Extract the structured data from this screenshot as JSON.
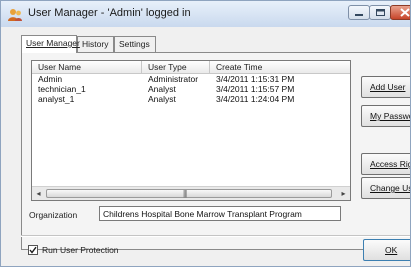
{
  "window": {
    "title": "User Manager - 'Admin' logged in"
  },
  "tabs": [
    {
      "label": "User Manager",
      "active": true
    },
    {
      "label": "History",
      "active": false
    },
    {
      "label": "Settings",
      "active": false
    }
  ],
  "user_table": {
    "columns": [
      "User Name",
      "User Type",
      "Create Time"
    ],
    "rows": [
      {
        "name": "Admin",
        "type": "Administrator",
        "created": "3/4/2011 1:15:31 PM"
      },
      {
        "name": "technician_1",
        "type": "Analyst",
        "created": "3/4/2011 1:15:57 PM"
      },
      {
        "name": "analyst_1",
        "type": "Analyst",
        "created": "3/4/2011 1:24:04 PM"
      }
    ]
  },
  "actions": {
    "add_user": "Add User",
    "my_password": "My Password",
    "access_rights": "Access Rights",
    "change_user": "Change User"
  },
  "organization": {
    "label": "Organization",
    "value": "Childrens Hospital Bone Marrow Transplant Program"
  },
  "protection": {
    "label": "Run User Protection",
    "checked": true
  },
  "ok_label": "OK",
  "icons": {
    "app": "user-manager-icon",
    "minimize": "minimize-icon",
    "maximize": "maximize-icon",
    "close": "close-icon",
    "scroll_left": "arrow-left-icon",
    "scroll_right": "arrow-right-icon",
    "check": "checkmark-icon"
  },
  "colors": {
    "title_gradient_top": "#e8f0fa",
    "title_gradient_bottom": "#c9d9ee",
    "close_button": "#c7452a",
    "default_button_border": "#3c7fb1"
  }
}
